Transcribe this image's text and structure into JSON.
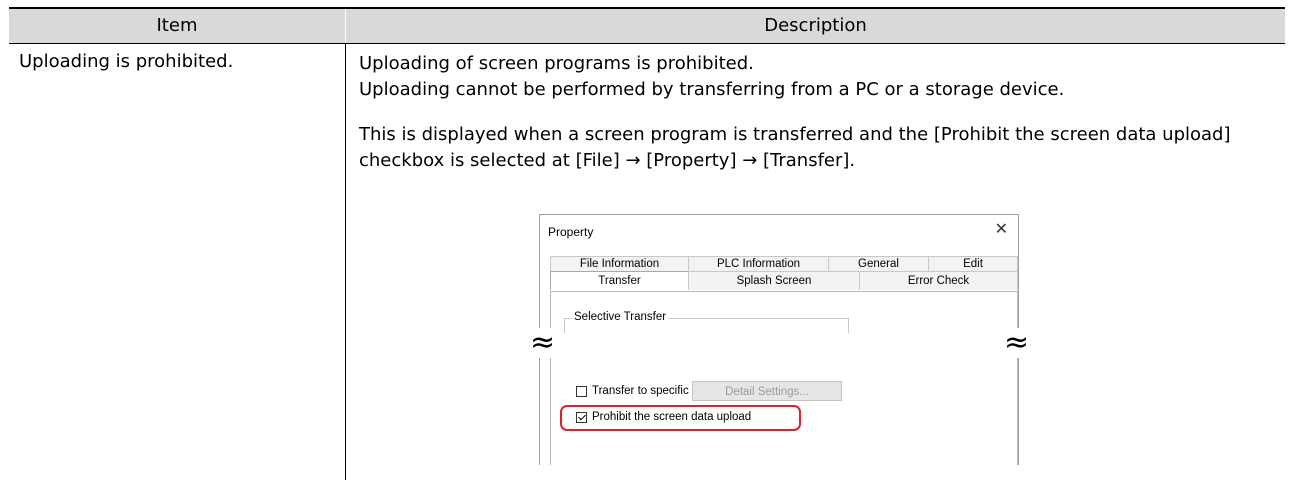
{
  "table": {
    "header": {
      "item": "Item",
      "description": "Description"
    },
    "row": {
      "item": "Uploading is prohibited.",
      "desc_line1": "Uploading of screen programs is prohibited.",
      "desc_line2": "Uploading cannot be performed by transferring from a PC or a storage device.",
      "desc_line3": "This is displayed when a screen program is transferred and the [Prohibit the screen data upload]",
      "desc_line4": "checkbox is selected at [File] → [Property] → [Transfer]."
    }
  },
  "dialog": {
    "title": "Property",
    "close_glyph": "✕",
    "tabs_row1": [
      "File Information",
      "PLC Information",
      "General",
      "Edit"
    ],
    "tabs_row2": [
      "Transfer",
      "Splash Screen",
      "Error Check"
    ],
    "active_tab": "Transfer",
    "group_label": "Selective Transfer",
    "checkbox_specific_unit": {
      "label": "Transfer to specific unit only",
      "checked": false
    },
    "detail_button": "Detail Settings...",
    "checkbox_prohibit_upload": {
      "label": "Prohibit the screen data upload",
      "checked": true
    },
    "highlight_color": "#e0202a"
  },
  "break_mark": "≈",
  "colors": {
    "header_bg": "#d9d9d9"
  }
}
